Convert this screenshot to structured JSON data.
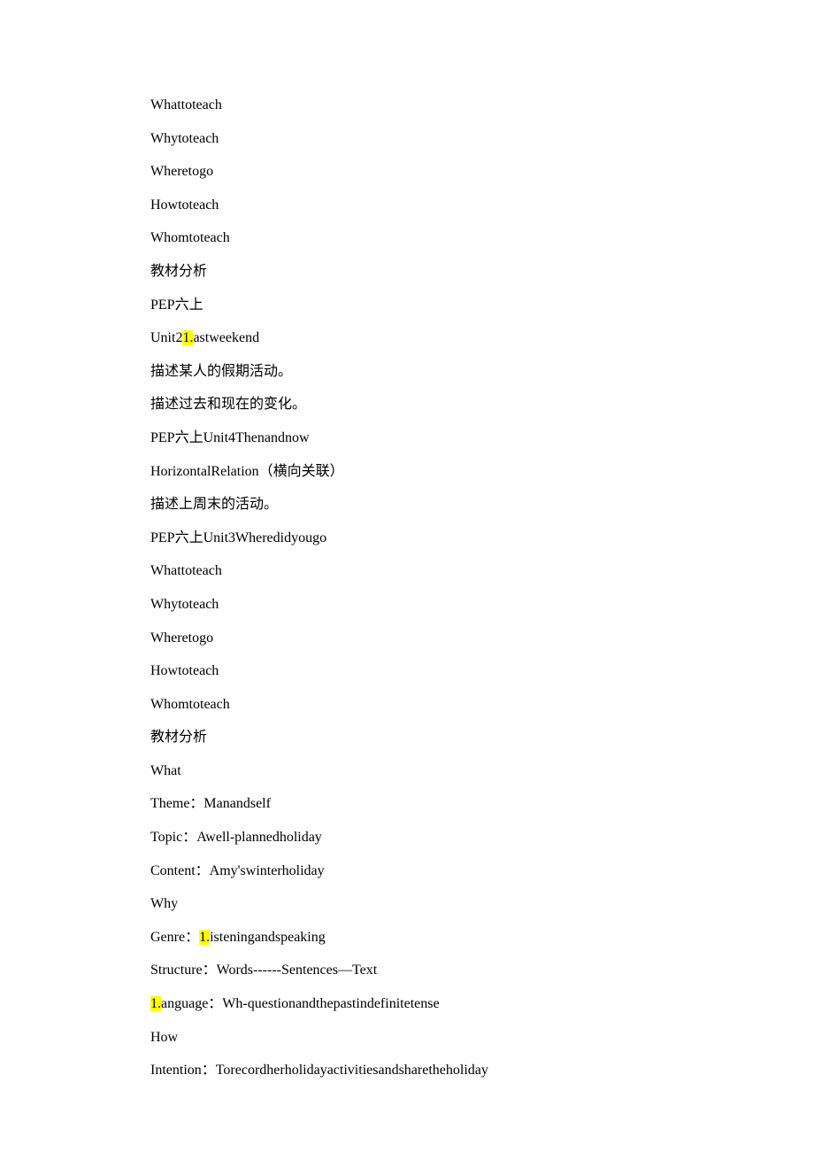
{
  "lines": [
    {
      "text": "Whattoteach"
    },
    {
      "text": "Whytoteach"
    },
    {
      "text": "Wheretogo"
    },
    {
      "text": "Howtoteach"
    },
    {
      "text": "Whomtoteach"
    },
    {
      "text": "教材分析"
    },
    {
      "text": "PEP六上"
    },
    {
      "prefix": "Unit2",
      "highlighted": "1.",
      "suffix": "astweekend"
    },
    {
      "text": "描述某人的假期活动。"
    },
    {
      "text": "描述过去和现在的变化。"
    },
    {
      "text": "PEP六上Unit4Thenandnow"
    },
    {
      "text": "HorizontalRelation（横向关联）"
    },
    {
      "text": "描述上周末的活动。"
    },
    {
      "text": "PEP六上Unit3Wheredidyougo"
    },
    {
      "text": "Whattoteach"
    },
    {
      "text": "Whytoteach"
    },
    {
      "text": "Wheretogo"
    },
    {
      "text": "Howtoteach"
    },
    {
      "text": "Whomtoteach"
    },
    {
      "text": "教材分析"
    },
    {
      "text": "What"
    },
    {
      "text": "Theme：Manandself"
    },
    {
      "text": "Topic：Awell-plannedholiday"
    },
    {
      "text": "Content：Amy'swinterholiday"
    },
    {
      "text": "Why"
    },
    {
      "prefix": "Genre：",
      "highlighted": "1.",
      "suffix": "isteningandspeaking"
    },
    {
      "text": "Structure：Words------Sentences—Text"
    },
    {
      "prefix": "",
      "highlighted": "1.",
      "suffix": "anguage：Wh-questionandthepastindefinitetense"
    },
    {
      "text": "How"
    },
    {
      "text": "Intention：Torecordherholidayactivitiesandsharetheholiday"
    }
  ]
}
